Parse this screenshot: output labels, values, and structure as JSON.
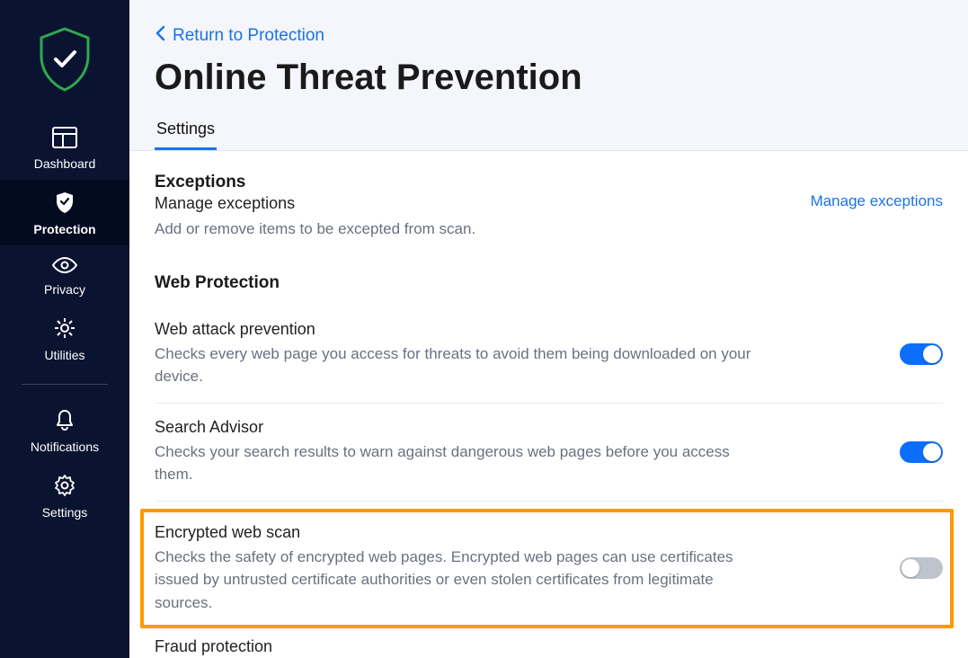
{
  "sidebar": {
    "items": [
      {
        "label": "Dashboard"
      },
      {
        "label": "Protection"
      },
      {
        "label": "Privacy"
      },
      {
        "label": "Utilities"
      },
      {
        "label": "Notifications"
      },
      {
        "label": "Settings"
      }
    ]
  },
  "header": {
    "back_label": "Return to Protection",
    "title": "Online Threat Prevention",
    "tabs": [
      {
        "label": "Settings"
      }
    ]
  },
  "exceptions": {
    "section_title": "Exceptions",
    "sub_title": "Manage exceptions",
    "sub_desc": "Add or remove items to be excepted from scan.",
    "link_label": "Manage exceptions"
  },
  "web_protection": {
    "section_title": "Web Protection",
    "items": [
      {
        "title": "Web attack prevention",
        "desc": "Checks every web page you access for threats to avoid them being downloaded on your device.",
        "on": true
      },
      {
        "title": "Search Advisor",
        "desc": "Checks your search results to warn against dangerous web pages before you access them.",
        "on": true
      },
      {
        "title": "Encrypted web scan",
        "desc": "Checks the safety of encrypted web pages. Encrypted web pages can use certificates issued by untrusted certificate authorities or even stolen certificates from legitimate sources.",
        "on": false
      },
      {
        "title": "Fraud protection",
        "desc": "",
        "on": true
      }
    ]
  }
}
